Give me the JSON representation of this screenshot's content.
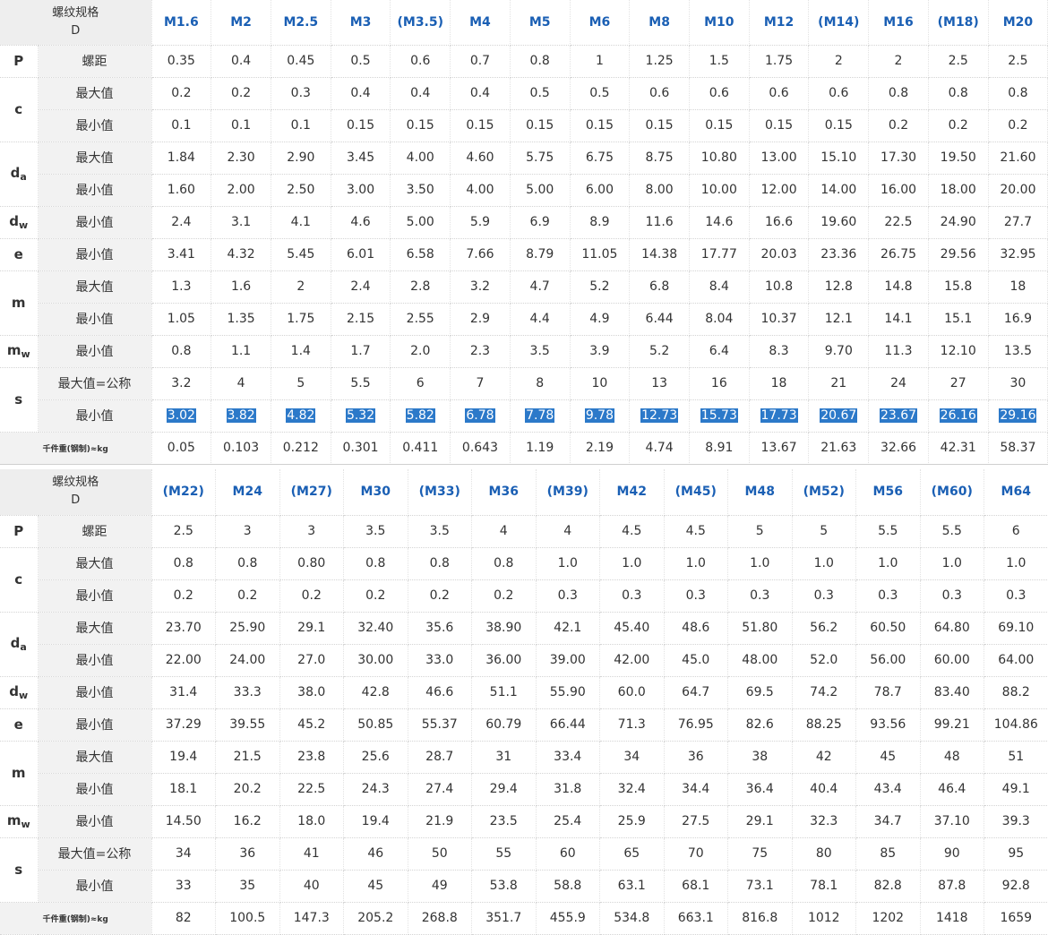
{
  "accent_color": "#1a5fb4",
  "highlight_color": "#2c79c9",
  "header_label": "螺纹规格",
  "header_sub": "D",
  "tables": [
    {
      "sizes": [
        "M1.6",
        "M2",
        "M2.5",
        "M3",
        "(M3.5)",
        "M4",
        "M5",
        "M6",
        "M8",
        "M10",
        "M12",
        "(M14)",
        "M16",
        "(M18)",
        "M20"
      ],
      "rows": [
        {
          "sym": "P",
          "sub": "",
          "label": "螺距",
          "values": [
            "0.35",
            "0.4",
            "0.45",
            "0.5",
            "0.6",
            "0.7",
            "0.8",
            "1",
            "1.25",
            "1.5",
            "1.75",
            "2",
            "2",
            "2.5",
            "2.5"
          ]
        },
        {
          "sym": "c",
          "sub": "",
          "label": "最大值",
          "values": [
            "0.2",
            "0.2",
            "0.3",
            "0.4",
            "0.4",
            "0.4",
            "0.5",
            "0.5",
            "0.6",
            "0.6",
            "0.6",
            "0.6",
            "0.8",
            "0.8",
            "0.8"
          ]
        },
        {
          "sym": "c",
          "sub": "",
          "label": "最小值",
          "values": [
            "0.1",
            "0.1",
            "0.1",
            "0.15",
            "0.15",
            "0.15",
            "0.15",
            "0.15",
            "0.15",
            "0.15",
            "0.15",
            "0.15",
            "0.2",
            "0.2",
            "0.2"
          ]
        },
        {
          "sym": "d",
          "sub": "a",
          "label": "最大值",
          "values": [
            "1.84",
            "2.30",
            "2.90",
            "3.45",
            "4.00",
            "4.60",
            "5.75",
            "6.75",
            "8.75",
            "10.80",
            "13.00",
            "15.10",
            "17.30",
            "19.50",
            "21.60"
          ]
        },
        {
          "sym": "d",
          "sub": "a",
          "label": "最小值",
          "values": [
            "1.60",
            "2.00",
            "2.50",
            "3.00",
            "3.50",
            "4.00",
            "5.00",
            "6.00",
            "8.00",
            "10.00",
            "12.00",
            "14.00",
            "16.00",
            "18.00",
            "20.00"
          ]
        },
        {
          "sym": "d",
          "sub": "w",
          "label": "最小值",
          "values": [
            "2.4",
            "3.1",
            "4.1",
            "4.6",
            "5.00",
            "5.9",
            "6.9",
            "8.9",
            "11.6",
            "14.6",
            "16.6",
            "19.60",
            "22.5",
            "24.90",
            "27.7"
          ]
        },
        {
          "sym": "e",
          "sub": "",
          "label": "最小值",
          "values": [
            "3.41",
            "4.32",
            "5.45",
            "6.01",
            "6.58",
            "7.66",
            "8.79",
            "11.05",
            "14.38",
            "17.77",
            "20.03",
            "23.36",
            "26.75",
            "29.56",
            "32.95"
          ]
        },
        {
          "sym": "m",
          "sub": "",
          "label": "最大值",
          "values": [
            "1.3",
            "1.6",
            "2",
            "2.4",
            "2.8",
            "3.2",
            "4.7",
            "5.2",
            "6.8",
            "8.4",
            "10.8",
            "12.8",
            "14.8",
            "15.8",
            "18"
          ]
        },
        {
          "sym": "m",
          "sub": "",
          "label": "最小值",
          "values": [
            "1.05",
            "1.35",
            "1.75",
            "2.15",
            "2.55",
            "2.9",
            "4.4",
            "4.9",
            "6.44",
            "8.04",
            "10.37",
            "12.1",
            "14.1",
            "15.1",
            "16.9"
          ]
        },
        {
          "sym": "m",
          "sub": "w",
          "label": "最小值",
          "values": [
            "0.8",
            "1.1",
            "1.4",
            "1.7",
            "2.0",
            "2.3",
            "3.5",
            "3.9",
            "5.2",
            "6.4",
            "8.3",
            "9.70",
            "11.3",
            "12.10",
            "13.5"
          ]
        },
        {
          "sym": "s",
          "sub": "",
          "label": "最大值=公称",
          "values": [
            "3.2",
            "4",
            "5",
            "5.5",
            "6",
            "7",
            "8",
            "10",
            "13",
            "16",
            "18",
            "21",
            "24",
            "27",
            "30"
          ]
        },
        {
          "sym": "s",
          "sub": "",
          "label": "最小值",
          "highlight": true,
          "values": [
            "3.02",
            "3.82",
            "4.82",
            "5.32",
            "5.82",
            "6.78",
            "7.78",
            "9.78",
            "12.73",
            "15.73",
            "17.73",
            "20.67",
            "23.67",
            "26.16",
            "29.16"
          ]
        },
        {
          "sym": "",
          "sub": "",
          "label": "千件重(钢制)≈kg",
          "weight": true,
          "values": [
            "0.05",
            "0.103",
            "0.212",
            "0.301",
            "0.411",
            "0.643",
            "1.19",
            "2.19",
            "4.74",
            "8.91",
            "13.67",
            "21.63",
            "32.66",
            "42.31",
            "58.37"
          ]
        }
      ]
    },
    {
      "sizes": [
        "(M22)",
        "M24",
        "(M27)",
        "M30",
        "(M33)",
        "M36",
        "(M39)",
        "M42",
        "(M45)",
        "M48",
        "(M52)",
        "M56",
        "(M60)",
        "M64"
      ],
      "rows": [
        {
          "sym": "P",
          "sub": "",
          "label": "螺距",
          "values": [
            "2.5",
            "3",
            "3",
            "3.5",
            "3.5",
            "4",
            "4",
            "4.5",
            "4.5",
            "5",
            "5",
            "5.5",
            "5.5",
            "6"
          ]
        },
        {
          "sym": "c",
          "sub": "",
          "label": "最大值",
          "values": [
            "0.8",
            "0.8",
            "0.80",
            "0.8",
            "0.8",
            "0.8",
            "1.0",
            "1.0",
            "1.0",
            "1.0",
            "1.0",
            "1.0",
            "1.0",
            "1.0"
          ]
        },
        {
          "sym": "c",
          "sub": "",
          "label": "最小值",
          "values": [
            "0.2",
            "0.2",
            "0.2",
            "0.2",
            "0.2",
            "0.2",
            "0.3",
            "0.3",
            "0.3",
            "0.3",
            "0.3",
            "0.3",
            "0.3",
            "0.3"
          ]
        },
        {
          "sym": "d",
          "sub": "a",
          "label": "最大值",
          "values": [
            "23.70",
            "25.90",
            "29.1",
            "32.40",
            "35.6",
            "38.90",
            "42.1",
            "45.40",
            "48.6",
            "51.80",
            "56.2",
            "60.50",
            "64.80",
            "69.10"
          ]
        },
        {
          "sym": "d",
          "sub": "a",
          "label": "最小值",
          "values": [
            "22.00",
            "24.00",
            "27.0",
            "30.00",
            "33.0",
            "36.00",
            "39.00",
            "42.00",
            "45.0",
            "48.00",
            "52.0",
            "56.00",
            "60.00",
            "64.00"
          ]
        },
        {
          "sym": "d",
          "sub": "w",
          "label": "最小值",
          "values": [
            "31.4",
            "33.3",
            "38.0",
            "42.8",
            "46.6",
            "51.1",
            "55.90",
            "60.0",
            "64.7",
            "69.5",
            "74.2",
            "78.7",
            "83.40",
            "88.2"
          ]
        },
        {
          "sym": "e",
          "sub": "",
          "label": "最小值",
          "values": [
            "37.29",
            "39.55",
            "45.2",
            "50.85",
            "55.37",
            "60.79",
            "66.44",
            "71.3",
            "76.95",
            "82.6",
            "88.25",
            "93.56",
            "99.21",
            "104.86"
          ]
        },
        {
          "sym": "m",
          "sub": "",
          "label": "最大值",
          "values": [
            "19.4",
            "21.5",
            "23.8",
            "25.6",
            "28.7",
            "31",
            "33.4",
            "34",
            "36",
            "38",
            "42",
            "45",
            "48",
            "51"
          ]
        },
        {
          "sym": "m",
          "sub": "",
          "label": "最小值",
          "values": [
            "18.1",
            "20.2",
            "22.5",
            "24.3",
            "27.4",
            "29.4",
            "31.8",
            "32.4",
            "34.4",
            "36.4",
            "40.4",
            "43.4",
            "46.4",
            "49.1"
          ]
        },
        {
          "sym": "m",
          "sub": "w",
          "label": "最小值",
          "values": [
            "14.50",
            "16.2",
            "18.0",
            "19.4",
            "21.9",
            "23.5",
            "25.4",
            "25.9",
            "27.5",
            "29.1",
            "32.3",
            "34.7",
            "37.10",
            "39.3"
          ]
        },
        {
          "sym": "s",
          "sub": "",
          "label": "最大值=公称",
          "values": [
            "34",
            "36",
            "41",
            "46",
            "50",
            "55",
            "60",
            "65",
            "70",
            "75",
            "80",
            "85",
            "90",
            "95"
          ]
        },
        {
          "sym": "s",
          "sub": "",
          "label": "最小值",
          "values": [
            "33",
            "35",
            "40",
            "45",
            "49",
            "53.8",
            "58.8",
            "63.1",
            "68.1",
            "73.1",
            "78.1",
            "82.8",
            "87.8",
            "92.8"
          ]
        },
        {
          "sym": "",
          "sub": "",
          "label": "千件重(钢制)≈kg",
          "weight": true,
          "values": [
            "82",
            "100.5",
            "147.3",
            "205.2",
            "268.8",
            "351.7",
            "455.9",
            "534.8",
            "663.1",
            "816.8",
            "1012",
            "1202",
            "1418",
            "1659"
          ]
        }
      ]
    }
  ]
}
